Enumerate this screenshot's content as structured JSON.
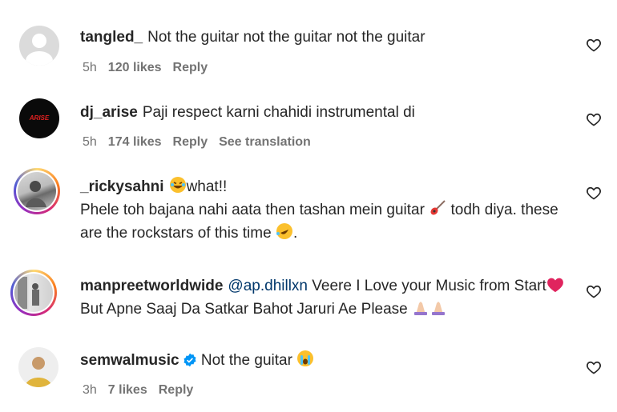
{
  "comments": [
    {
      "username": "tangled_",
      "text": "Not the guitar not the guitar not the guitar",
      "time": "5h",
      "likes": "120 likes",
      "reply": "Reply"
    },
    {
      "username": "dj_arise",
      "text": "Paji respect karni chahidi instrumental di",
      "time": "5h",
      "likes": "174 likes",
      "reply": "Reply",
      "see_translation": "See translation",
      "avatar_text": "ARISE"
    },
    {
      "username": "_rickysahni",
      "text_a": "what!!",
      "text_b": "Phele toh bajana nahi aata then tashan mein guitar",
      "text_c": "todh diya. these are the rockstars of this time",
      "text_d": "."
    },
    {
      "username": "manpreetworldwide",
      "mention": "@ap.dhillxn",
      "text_a": "Veere I Love your Music from Start",
      "text_b": "But Apne Saaj Da Satkar Bahot Jaruri Ae Please"
    },
    {
      "username": "semwalmusic",
      "text": "Not the guitar",
      "time": "3h",
      "likes": "7 likes",
      "reply": "Reply"
    }
  ],
  "icons": {
    "like": "heart-outline-icon",
    "verified": "verified-badge-icon"
  },
  "colors": {
    "ring_start": "#feda75",
    "ring_end": "#962fbf",
    "verified": "#0095f6",
    "heart_emoji": "#e0245e"
  }
}
